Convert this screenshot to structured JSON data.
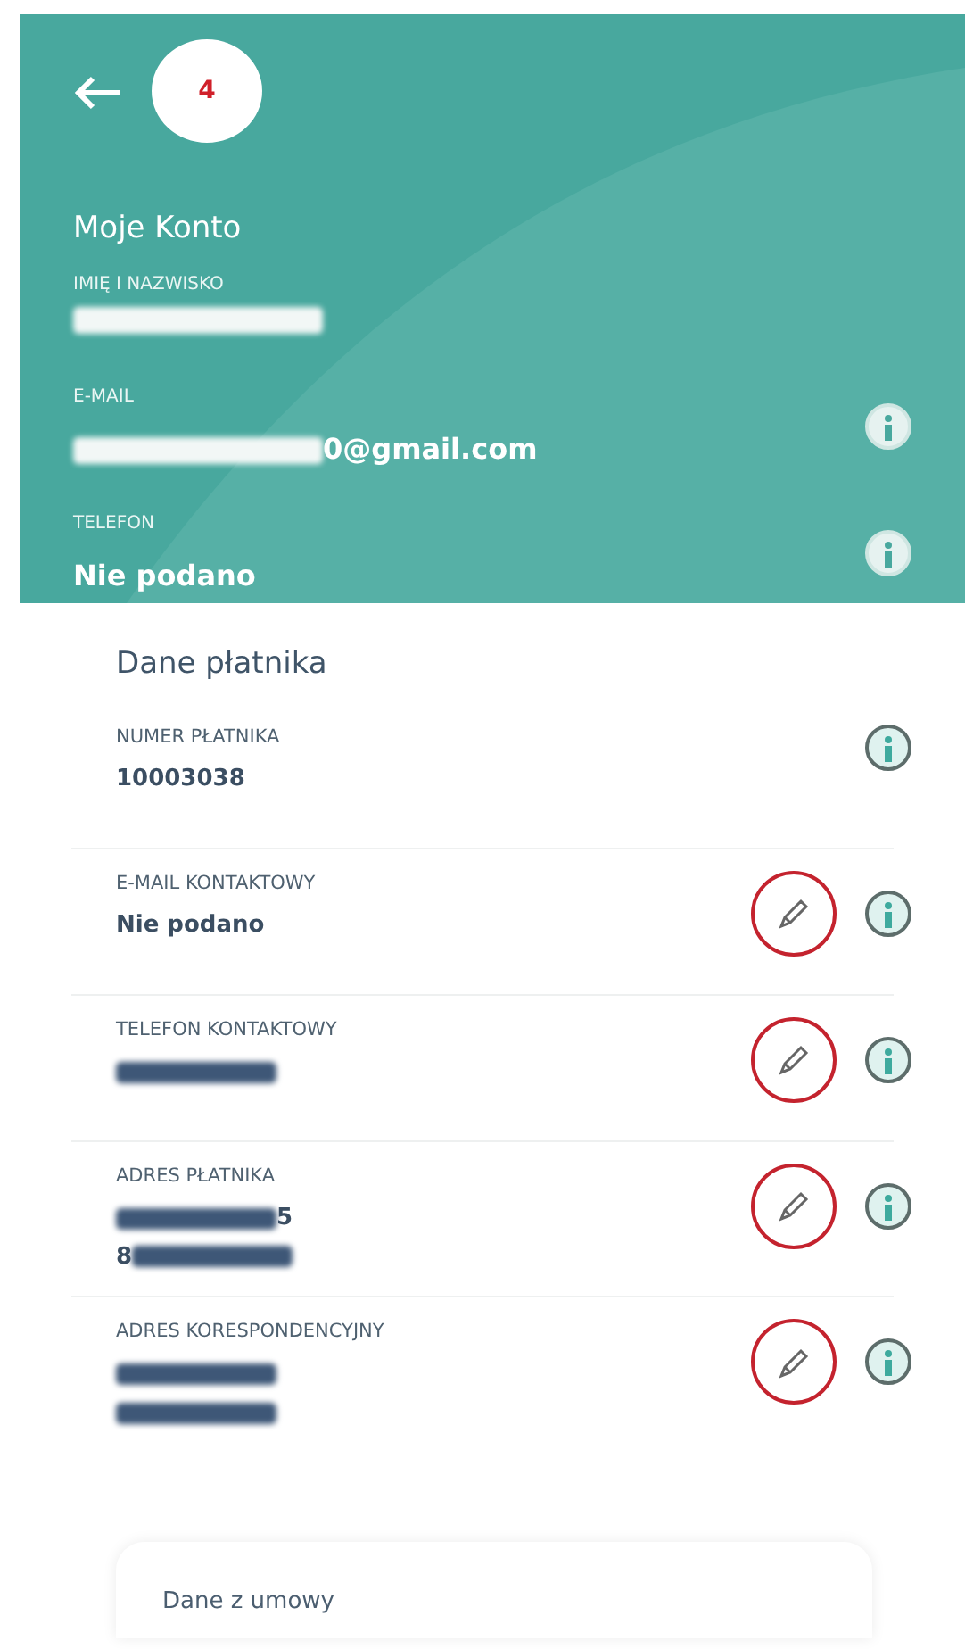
{
  "header": {
    "badge": "4",
    "title": "Moje Konto",
    "fields": [
      {
        "label": "IMIĘ I NAZWISKO",
        "parts": [
          {
            "kind": "redaction"
          }
        ],
        "info": false
      },
      {
        "label": "E-MAIL",
        "parts": [
          {
            "kind": "redaction"
          },
          {
            "kind": "text",
            "text": "0@gmail.com"
          }
        ],
        "info": true
      },
      {
        "label": "TELEFON",
        "parts": [
          {
            "kind": "text",
            "text": "Nie podano"
          }
        ],
        "info": true
      }
    ]
  },
  "payer": {
    "title": "Dane płatnika",
    "rows": [
      {
        "label": "NUMER PŁATNIKA",
        "lines": [
          [
            {
              "kind": "text",
              "text": "10003038"
            }
          ]
        ],
        "editable": false
      },
      {
        "label": "E-MAIL KONTAKTOWY",
        "lines": [
          [
            {
              "kind": "text",
              "text": "Nie podano"
            }
          ]
        ],
        "editable": true
      },
      {
        "label": "TELEFON KONTAKTOWY",
        "lines": [
          [
            {
              "kind": "redaction"
            }
          ]
        ],
        "editable": true
      },
      {
        "label": "ADRES PŁATNIKA",
        "lines": [
          [
            {
              "kind": "redaction"
            },
            {
              "kind": "text",
              "text": "5"
            }
          ],
          [
            {
              "kind": "text",
              "text": "8"
            },
            {
              "kind": "redaction"
            }
          ]
        ],
        "editable": true
      },
      {
        "label": "ADRES KORESPONDENCYJNY",
        "lines": [
          [
            {
              "kind": "redaction"
            }
          ],
          [
            {
              "kind": "redaction"
            }
          ]
        ],
        "editable": true
      }
    ]
  },
  "contract_card": {
    "title": "Dane z umowy"
  }
}
